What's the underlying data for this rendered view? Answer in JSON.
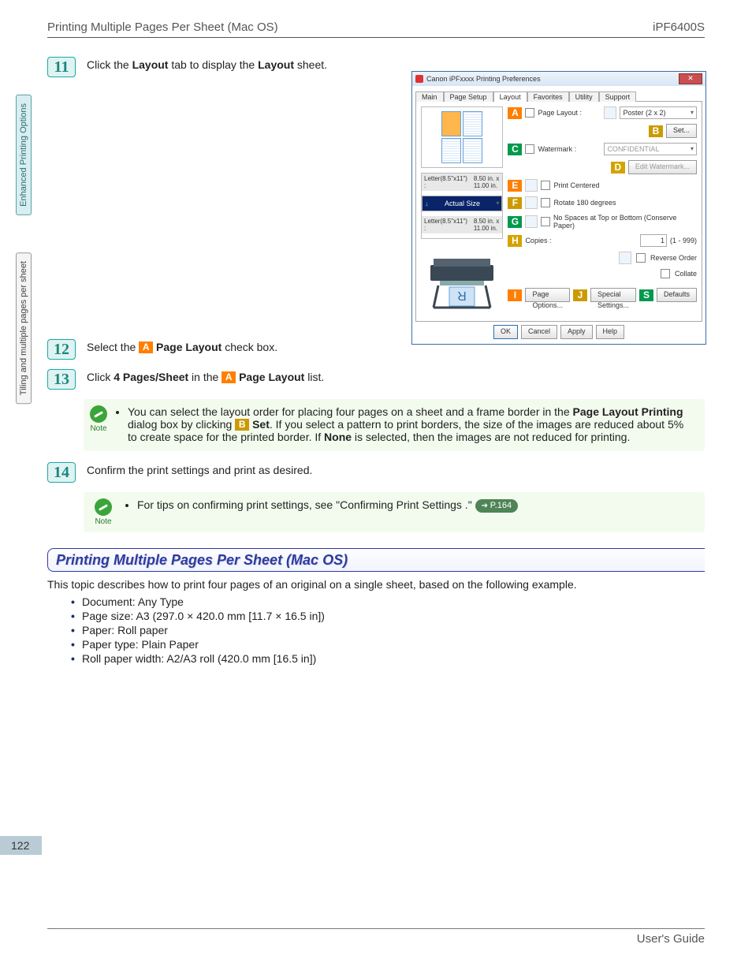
{
  "header": {
    "title": "Printing Multiple Pages Per Sheet (Mac OS)",
    "model": "iPF6400S"
  },
  "sidebar": {
    "tab1": "Enhanced Printing Options",
    "tab2": "Tiling and multiple pages per sheet"
  },
  "page_number": "122",
  "footer": "User's Guide",
  "step11": {
    "num": "11",
    "t1": "Click the ",
    "b1": "Layout",
    "t2": " tab to display the ",
    "b2": "Layout",
    "t3": " sheet."
  },
  "step12": {
    "num": "12",
    "t1": "Select the ",
    "mkA": "A",
    "b1": "Page Layout",
    "t2": " check box."
  },
  "step13": {
    "num": "13",
    "t1": "Click ",
    "b1": "4 Pages/Sheet",
    "t2": " in the ",
    "mkA": "A",
    "b2": "Page Layout",
    "t3": " list."
  },
  "note13": {
    "label": "Note",
    "t1": "You can select the layout order for placing four pages on a sheet and a frame border in the ",
    "b1": "Page Layout Printing",
    "t2": " dialog box by clicking ",
    "mkB": "B",
    "b2": "Set",
    "t3": ". If you select a pattern to print borders, the size of the images are reduced about 5% to create space for the printed border. If ",
    "b3": "None",
    "t4": " is selected, then the images are not reduced for printing."
  },
  "step14": {
    "num": "14",
    "t1": "Confirm the print settings and print as desired."
  },
  "note14": {
    "label": "Note",
    "t1": "For tips on confirming print settings, see \"Confirming Print Settings .\" ",
    "pref": "P.164"
  },
  "section": {
    "title": "Printing Multiple Pages Per Sheet (Mac OS)",
    "intro": "This topic describes how to print four pages of an original on a single sheet, based on the following example.",
    "items": [
      "Document: Any Type",
      "Page size: A3 (297.0 × 420.0 mm [11.7 × 16.5 in])",
      "Paper: Roll paper",
      "Paper type: Plain Paper",
      "Roll paper width: A2/A3 roll (420.0 mm [16.5 in])"
    ]
  },
  "dialog": {
    "title": "Canon iPFxxxx Printing Preferences",
    "tabs": [
      "Main",
      "Page Setup",
      "Layout",
      "Favorites",
      "Utility",
      "Support"
    ],
    "active_tab": 2,
    "markers": {
      "A": "A",
      "B": "B",
      "C": "C",
      "D": "D",
      "E": "E",
      "F": "F",
      "G": "G",
      "H": "H",
      "I": "I",
      "J": "J",
      "S": "S"
    },
    "labels": {
      "page_layout": "Page Layout :",
      "page_layout_val": "Poster (2 x 2)",
      "set": "Set...",
      "watermark": "Watermark :",
      "watermark_val": "CONFIDENTIAL",
      "edit_wm": "Edit Watermark...",
      "print_centered": "Print Centered",
      "rotate180": "Rotate 180 degrees",
      "no_spaces": "No Spaces at Top or Bottom (Conserve Paper)",
      "copies": "Copies :",
      "copies_val": "1",
      "copies_range": "(1 - 999)",
      "reverse": "Reverse Order",
      "collate": "Collate",
      "page_options": "Page Options...",
      "special": "Special Settings...",
      "defaults": "Defaults",
      "ok": "OK",
      "cancel": "Cancel",
      "apply": "Apply",
      "help": "Help"
    },
    "paper": {
      "hdr1": "Letter(8.5\"x11\") :",
      "dim": "8.50 in. x 11.00 in.",
      "actual": "Actual Size",
      "hdr2": "Letter(8.5\"x11\") :",
      "dim2": "8.50 in. x 11.00 in."
    }
  }
}
